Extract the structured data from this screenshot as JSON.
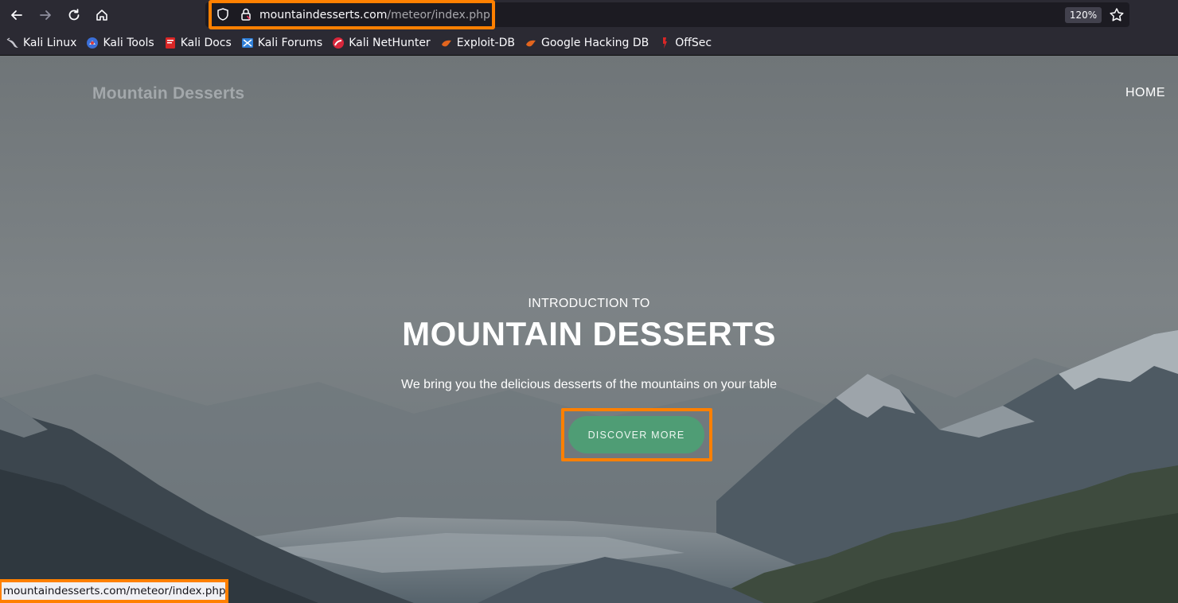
{
  "browser": {
    "url_domain": "mountaindesserts.com",
    "url_path": "/meteor/index.php",
    "zoom": "120%",
    "bookmarks": [
      {
        "label": "Kali Linux",
        "icon": "kali-dragon-icon"
      },
      {
        "label": "Kali Tools",
        "icon": "kali-tools-icon"
      },
      {
        "label": "Kali Docs",
        "icon": "kali-docs-icon"
      },
      {
        "label": "Kali Forums",
        "icon": "kali-forums-icon"
      },
      {
        "label": "Kali NetHunter",
        "icon": "nethunter-icon"
      },
      {
        "label": "Exploit-DB",
        "icon": "exploit-db-icon"
      },
      {
        "label": "Google Hacking DB",
        "icon": "ghdb-icon"
      },
      {
        "label": "OffSec",
        "icon": "offsec-icon"
      }
    ],
    "status_url": "mountaindesserts.com/meteor/index.php#"
  },
  "site": {
    "brand": "Mountain Desserts",
    "nav_home": "HOME",
    "hero": {
      "intro": "INTRODUCTION TO",
      "headline": "MOUNTAIN DESSERTS",
      "tagline": "We bring you the delicious desserts of the mountains on your table",
      "cta": "DISCOVER MORE"
    }
  },
  "colors": {
    "highlight": "#ff8000",
    "cta_bg": "#4f9d75",
    "chrome_bg": "#2b2a33"
  }
}
